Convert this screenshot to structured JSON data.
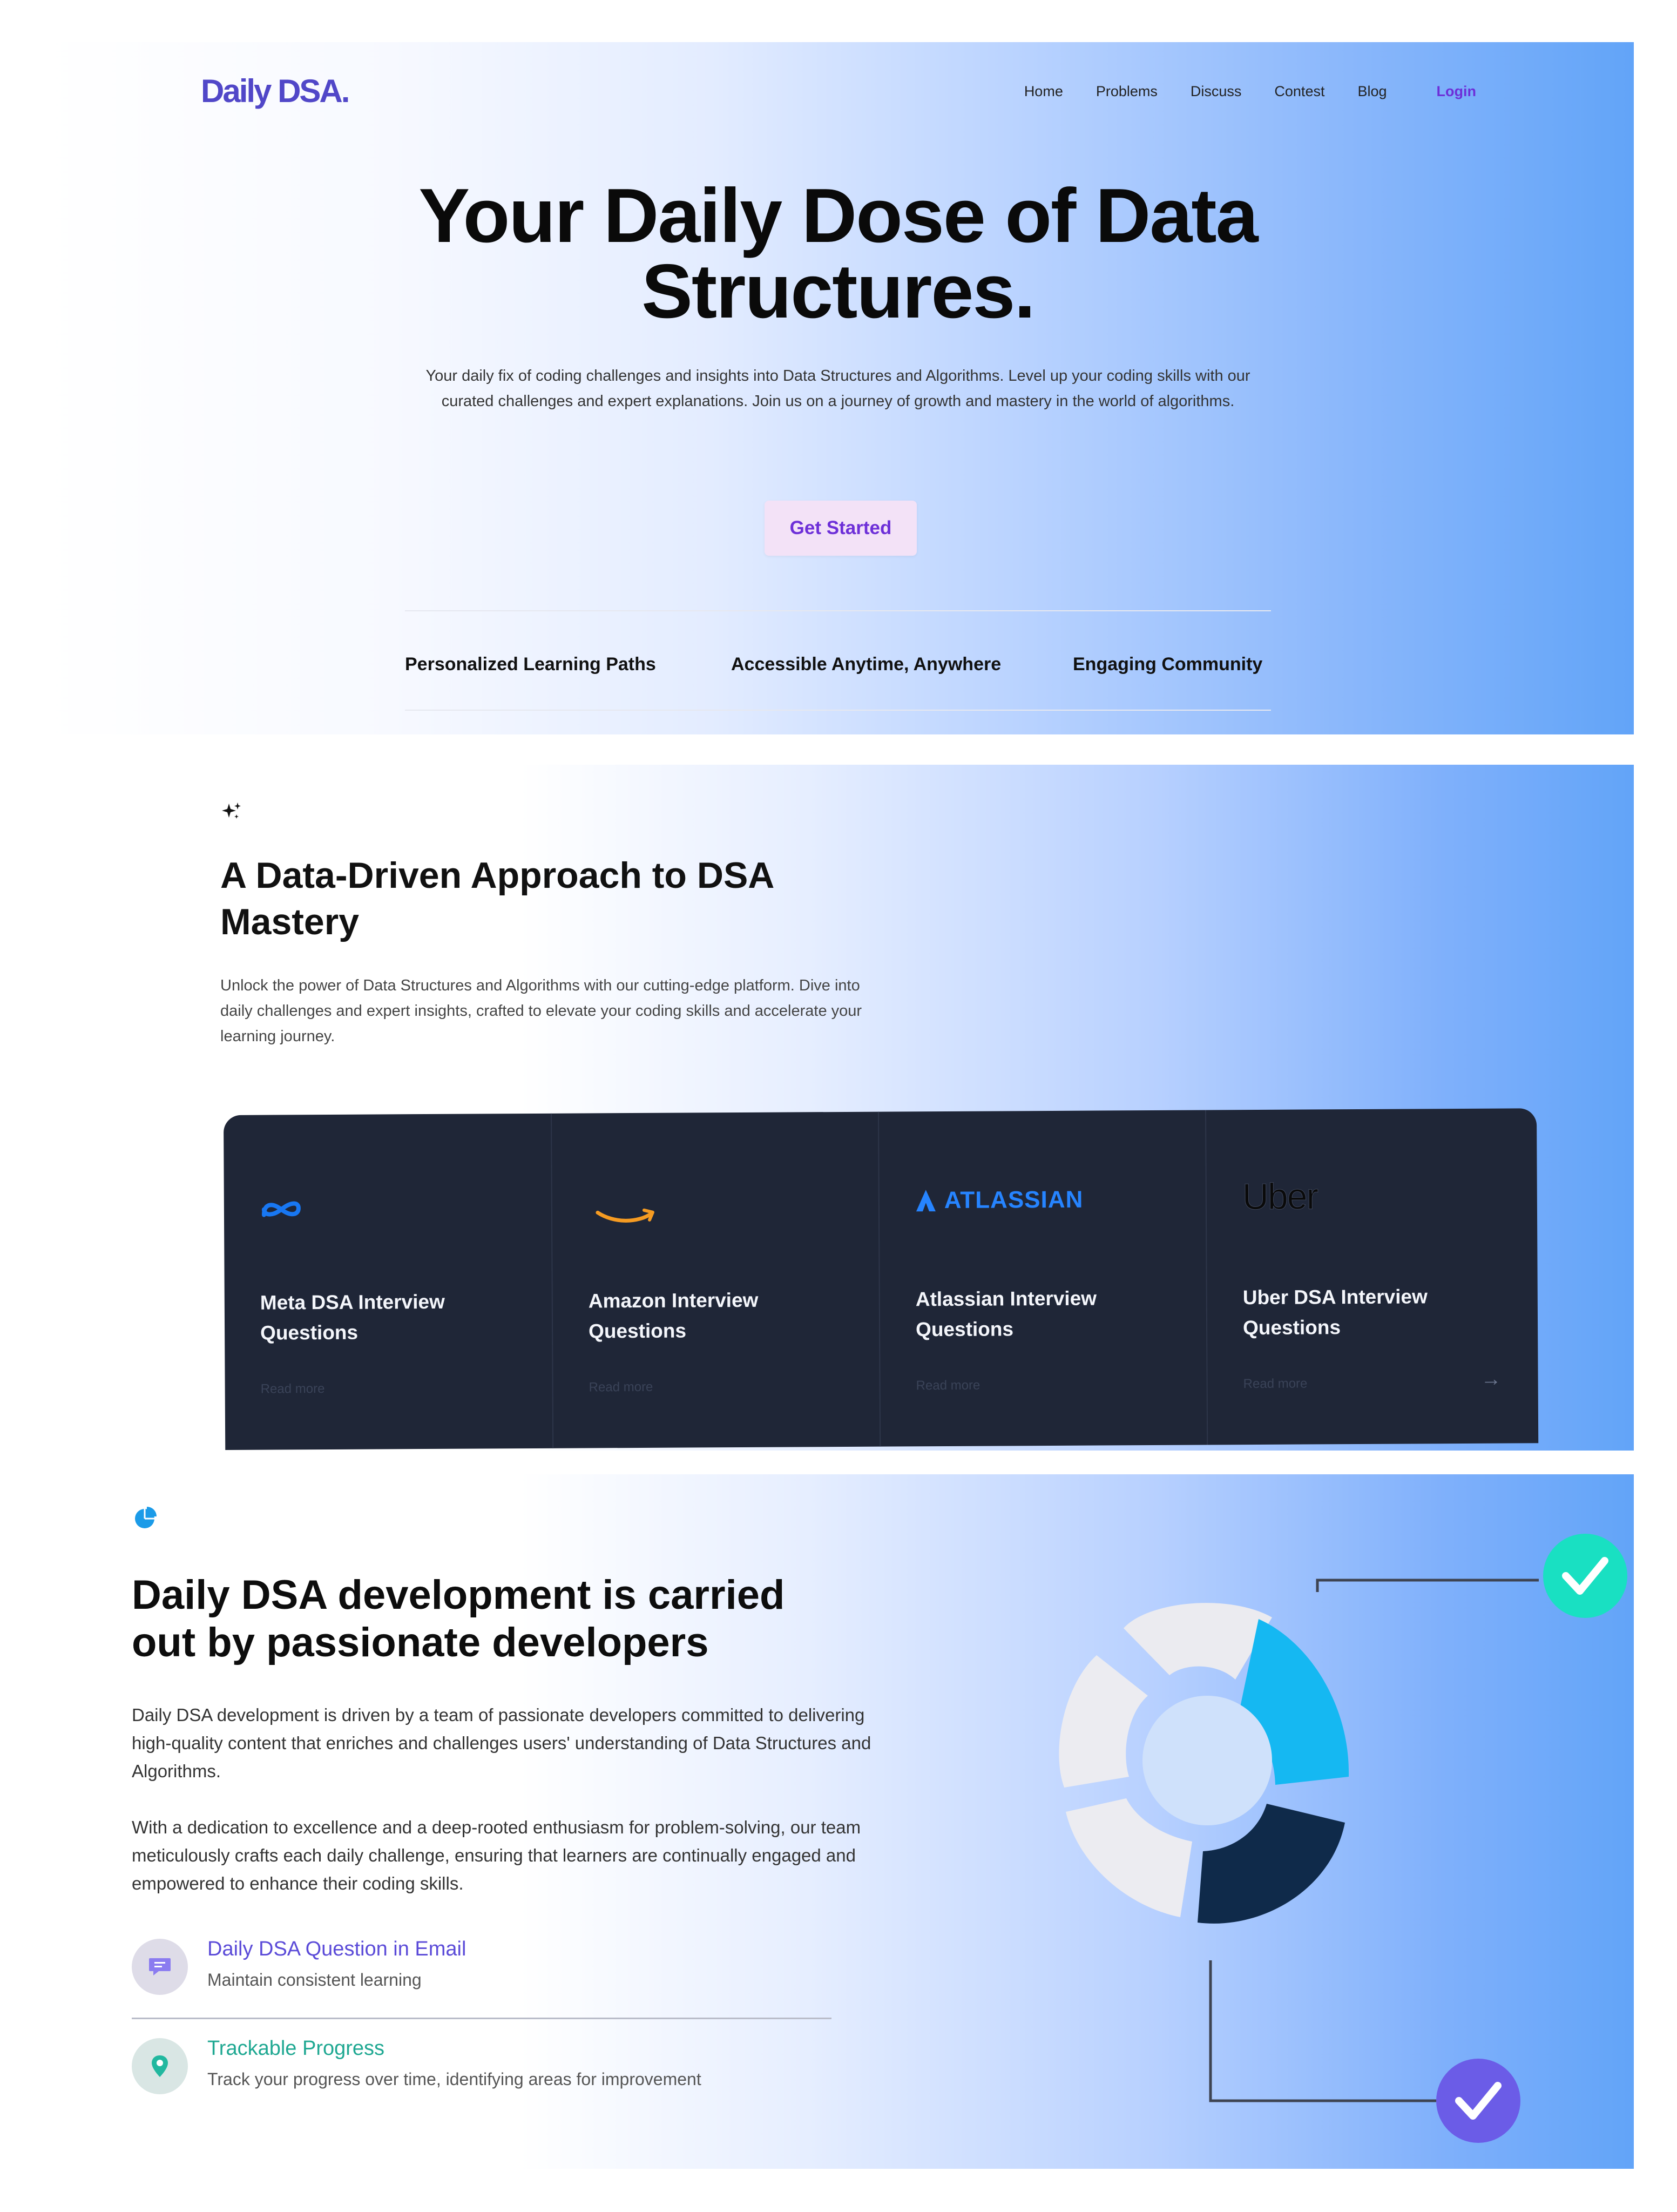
{
  "header": {
    "logo": "Daily DSA.",
    "nav": [
      "Home",
      "Problems",
      "Discuss",
      "Contest",
      "Blog"
    ],
    "login": "Login"
  },
  "hero": {
    "title_line1": "Your Daily Dose of Data",
    "title_line2": "Structures.",
    "subtitle": "Your daily fix of coding challenges and insights into Data Structures and Algorithms. Level up your coding skills with our curated challenges and expert explanations. Join us on a journey of growth and mastery in the world of algorithms.",
    "cta": "Get Started",
    "features": [
      "Personalized Learning Paths",
      "Accessible Anytime, Anywhere",
      "Engaging Community"
    ]
  },
  "approach": {
    "icon": "sparkles-icon",
    "title_line1": "A Data-Driven Approach to DSA",
    "title_line2": "Mastery",
    "body": "Unlock the power of Data Structures and Algorithms with our cutting-edge platform. Dive into daily challenges and expert insights, crafted to elevate your coding skills and accelerate your learning journey.",
    "cards": [
      {
        "logo": "meta-logo",
        "title": "Meta DSA Interview Questions",
        "link": "Read more"
      },
      {
        "logo": "amazon-logo",
        "title": "Amazon Interview Questions",
        "link": "Read more"
      },
      {
        "logo": "atlassian-logo",
        "logo_text": "ATLASSIAN",
        "title": "Atlassian Interview Questions",
        "link": "Read more"
      },
      {
        "logo": "uber-logo",
        "logo_text": "Uber",
        "title": "Uber DSA Interview Questions",
        "link": "Read more"
      }
    ]
  },
  "developers": {
    "icon": "pie-chart-icon",
    "title_line1": "Daily DSA development is carried",
    "title_line2": "out by passionate developers",
    "para1": "Daily DSA development is driven by a team of passionate developers committed to delivering high-quality content that enriches and challenges users' understanding of Data Structures and Algorithms.",
    "para2": "With a dedication to excellence and a deep-rooted enthusiasm for problem-solving, our team meticulously crafts each daily challenge, ensuring that learners are continually engaged and empowered to enhance their coding skills.",
    "features": [
      {
        "icon": "chat-bubble-icon",
        "title": "Daily DSA Question in Email",
        "subtitle": "Maintain consistent learning",
        "color": "#5b4bd8"
      },
      {
        "icon": "map-pin-icon",
        "title": "Trackable Progress",
        "subtitle": "Track your progress over time, identifying areas for improvement",
        "color": "#1fa892"
      }
    ]
  },
  "colors": {
    "brand": "#5147c8",
    "accent_purple": "#6d2fd8",
    "card_bg": "#1f2637",
    "teal_check": "#19e0c2",
    "violet_check": "#6b5ce7",
    "segment_cyan": "#15b8f2",
    "segment_navy": "#0f2a4a"
  }
}
